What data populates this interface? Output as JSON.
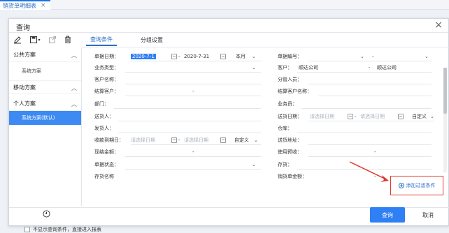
{
  "tab": {
    "label": "销货单明细表",
    "close": "×"
  },
  "dialog": {
    "title": "查询",
    "close": "×"
  },
  "toolbar": {
    "icons": [
      "edit-icon",
      "save-icon",
      "export-icon",
      "delete-icon"
    ]
  },
  "sidebar": {
    "groups": [
      {
        "label": "公共方案",
        "items": [
          {
            "label": "系统方案"
          }
        ]
      },
      {
        "label": "移动方案",
        "items": []
      },
      {
        "label": "个人方案",
        "items": [
          {
            "label": "系统方案(默认)"
          }
        ]
      }
    ]
  },
  "tabs": [
    {
      "label": "查询条件"
    },
    {
      "label": "分组设置"
    }
  ],
  "form": {
    "left": [
      {
        "label": "单据日期：",
        "from": "2020-7-1",
        "to": "2020-7-31",
        "period": "本月"
      },
      {
        "label": "业务类型："
      },
      {
        "label": "客户名称："
      },
      {
        "label": "结算客户：",
        "dash": "-"
      },
      {
        "label": "部门："
      },
      {
        "label": "送货人："
      },
      {
        "label": "发货人："
      },
      {
        "label": "收款到期日：",
        "from_ph": "请选择日期",
        "to_ph": "请选择日期",
        "custom": "自定义"
      },
      {
        "label": "现结金额：",
        "dash": "-"
      },
      {
        "label": "单据状态："
      },
      {
        "label": "存货名称"
      }
    ],
    "right": [
      {
        "label": "单据编号：",
        "dash": "-"
      },
      {
        "label": "客户：",
        "from": "顺达公司",
        "to": "顺达公司"
      },
      {
        "label": "分管人员："
      },
      {
        "label": "结算客户名称："
      },
      {
        "label": "业务员："
      },
      {
        "label": "送货日期：",
        "from_ph": "请选择日期",
        "to_ph": "请选择日期",
        "custom": "自定义"
      },
      {
        "label": "仓库："
      },
      {
        "label": "送货地址："
      },
      {
        "label": "使用预收：",
        "dash": "-"
      },
      {
        "label": "存货："
      },
      {
        "label": "销货单金额：",
        "dash": "-"
      }
    ]
  },
  "add_filter": "添加过滤条件",
  "footer": {
    "checkbox_label": "不显示查询条件，直接进入报表",
    "query": "查询",
    "cancel": "取消"
  },
  "colors": {
    "primary": "#2f7ff5",
    "highlight_border": "#e0382b"
  }
}
